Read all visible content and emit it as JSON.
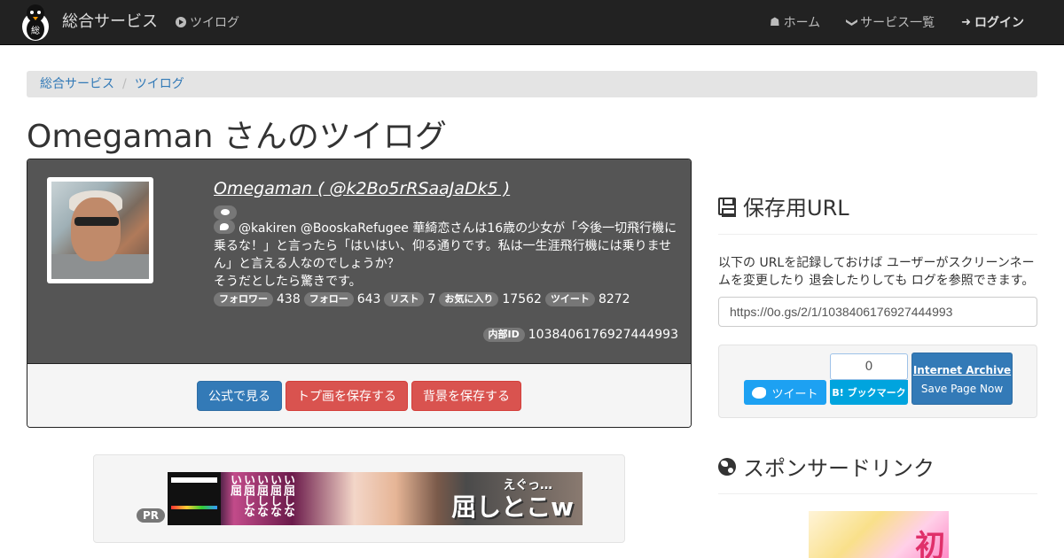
{
  "navbar": {
    "brand": "総合サービス",
    "brand_mark": "総",
    "left_link": "ツイログ",
    "home": "ホーム",
    "services": "サービス一覧",
    "login": "ログイン",
    "home_glyph": "☗",
    "services_glyph": "❯",
    "login_glyph": "➜"
  },
  "breadcrumb": {
    "items": [
      "総合サービス",
      "ツイログ"
    ],
    "sep": "/"
  },
  "page_title": "Omegaman さんのツイログ",
  "profile": {
    "name_link": "Omegaman ( @k2Bo5rRSaaJaDk5 )",
    "tweet": "@kakiren @BooskaRefugee 華綺恋さんは16歳の少女が「今後一切飛行機に乗るな！」と言ったら「はいはい、仰る通りです。私は一生涯飛行機には乗りません」と言える人なのでしょうか？",
    "tweet_line2": "そうだとしたら驚きです。",
    "stats": [
      {
        "label": "フォロワー",
        "value": "438"
      },
      {
        "label": "フォロー",
        "value": "643"
      },
      {
        "label": "リスト",
        "value": "7"
      },
      {
        "label": "お気に入り",
        "value": "17562"
      },
      {
        "label": "ツイート",
        "value": "8272"
      }
    ],
    "internal_label": "内部ID",
    "internal_id": "1038406176927444993",
    "buttons": {
      "official": "公式で見る",
      "save_icon": "トプ画を保存する",
      "save_bg": "背景を保存する"
    }
  },
  "ad": {
    "pr": "PR",
    "vertical_text": "い屈しない屈しない屈しない屈しない屈",
    "top_text": "えぐっ…",
    "big_text": "屈しとこw"
  },
  "sidebar": {
    "save_title": "保存用URL",
    "desc": "以下の URLを記録しておけば ユーザーがスクリーンネームを変更したり 退会したりしても ログを参照できます。",
    "url": "https://0o.gs/2/1/1038406176927444993",
    "tweet_btn": "ツイート",
    "hatena_count": "0",
    "hatena_btn": "B! ブックマーク",
    "ia_title": "Internet Archive",
    "ia_sub": "Save Page Now",
    "sponsor_title": "スポンサードリンク",
    "side_ad_text": "初"
  }
}
